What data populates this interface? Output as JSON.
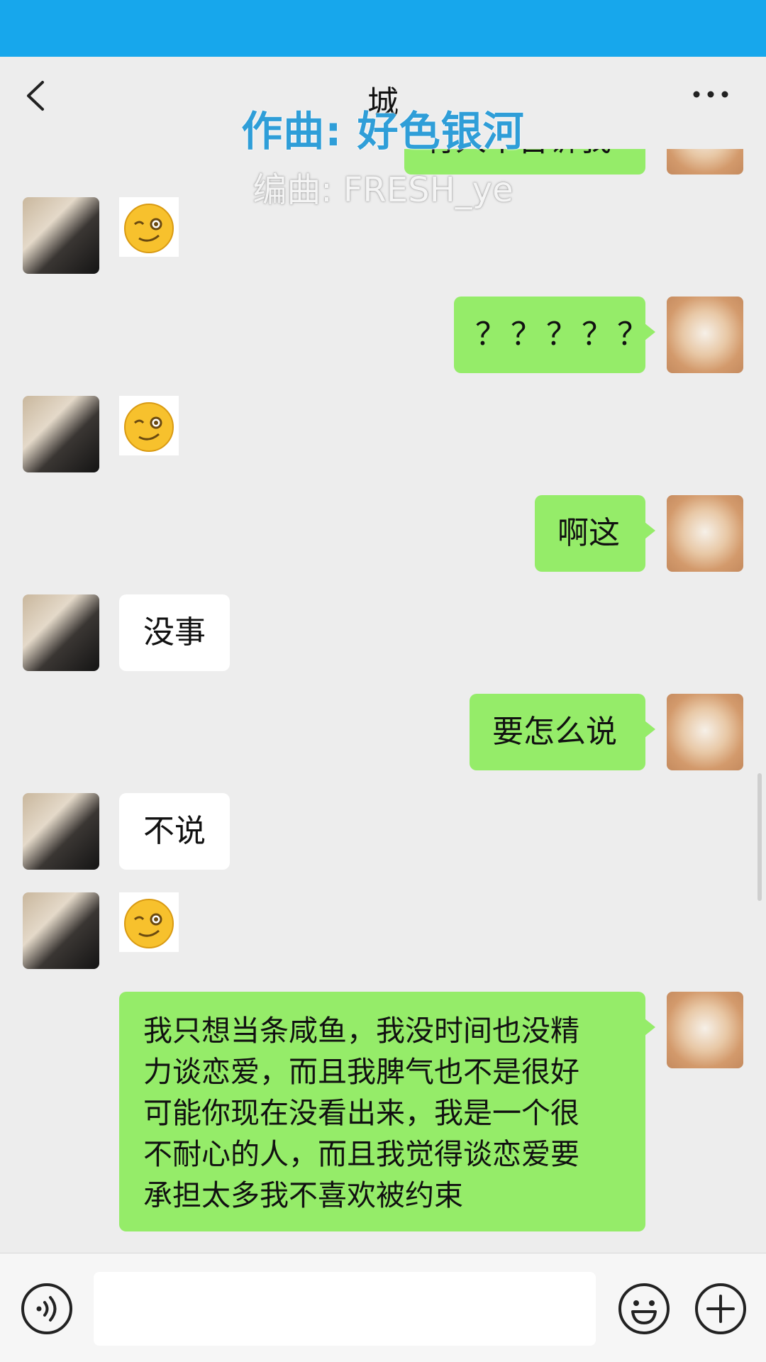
{
  "header": {
    "title": "城",
    "back_icon": "chevron-left-icon",
    "more_icon": "more-dots-icon"
  },
  "lyrics": {
    "line1": "作曲: 好色银河",
    "line2": "编曲: FRESH_ye"
  },
  "messages": [
    {
      "side": "right",
      "type": "text",
      "text": "有人不告诉我"
    },
    {
      "side": "left",
      "type": "sticker",
      "sticker": "smirk-emoji"
    },
    {
      "side": "right",
      "type": "text",
      "text": "？？？？？"
    },
    {
      "side": "left",
      "type": "sticker",
      "sticker": "smirk-emoji"
    },
    {
      "side": "right",
      "type": "text",
      "text": "啊这"
    },
    {
      "side": "left",
      "type": "text",
      "text": "没事"
    },
    {
      "side": "right",
      "type": "text",
      "text": "要怎么说"
    },
    {
      "side": "left",
      "type": "text",
      "text": "不说"
    },
    {
      "side": "left",
      "type": "sticker",
      "sticker": "smirk-emoji"
    },
    {
      "side": "right",
      "type": "text",
      "lines": [
        "我只想当条咸鱼，我没时间也没精",
        "力谈恋爱，而且我脾气也不是很好",
        "可能你现在没看出来，我是一个很",
        "不耐心的人，而且我觉得谈恋爱要",
        "承担太多我不喜欢被约束"
      ]
    }
  ],
  "input_bar": {
    "voice_icon": "voice-icon",
    "input_value": "",
    "emoji_icon": "emoji-icon",
    "plus_icon": "plus-icon"
  },
  "colors": {
    "top_strip": "#17a7ec",
    "background": "#ededed",
    "bubble_right": "#95ec69",
    "bubble_left": "#ffffff",
    "lyric_blue": "#2f9ed8"
  }
}
